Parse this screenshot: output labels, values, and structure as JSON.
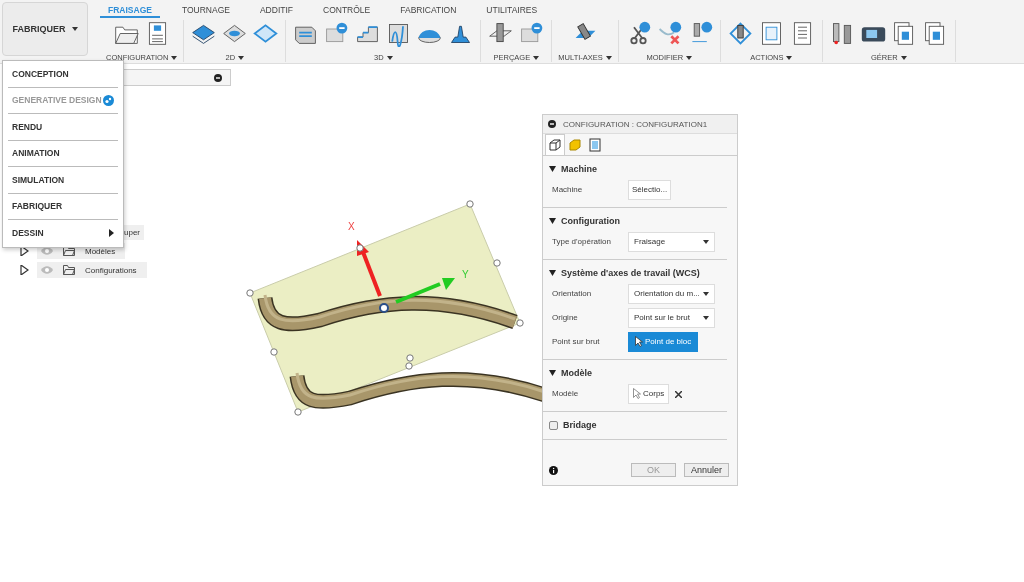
{
  "app_menu": {
    "label": "FABRIQUER"
  },
  "tabs": [
    {
      "label": "FRAISAGE",
      "selected": true
    },
    {
      "label": "TOURNAGE",
      "selected": false
    },
    {
      "label": "ADDITIF",
      "selected": false
    },
    {
      "label": "CONTRÔLE",
      "selected": false
    },
    {
      "label": "FABRICATION",
      "selected": false
    },
    {
      "label": "UTILITAIRES",
      "selected": false
    }
  ],
  "groups": [
    {
      "label": "CONFIGURATION"
    },
    {
      "label": "2D"
    },
    {
      "label": "3D"
    },
    {
      "label": "PERÇAGE"
    },
    {
      "label": "MULTI-AXES"
    },
    {
      "label": "MODIFIER"
    },
    {
      "label": "ACTIONS"
    },
    {
      "label": "GÉRER"
    }
  ],
  "workspace_menu": [
    {
      "label": "CONCEPTION",
      "kind": "plain",
      "disabled": false
    },
    {
      "label": "GENERATIVE DESIGN",
      "kind": "badge",
      "disabled": true
    },
    {
      "label": "RENDU",
      "kind": "plain",
      "disabled": false
    },
    {
      "label": "ANIMATION",
      "kind": "plain",
      "disabled": false
    },
    {
      "label": "SIMULATION",
      "kind": "plain",
      "disabled": false
    },
    {
      "label": "FABRIQUER",
      "kind": "plain",
      "disabled": false
    },
    {
      "label": "DESSIN",
      "kind": "submenu",
      "disabled": false
    }
  ],
  "browser": {
    "items": [
      {
        "label": "uper",
        "kind": "fragment"
      },
      {
        "label": "Modèles",
        "kind": "folder",
        "expanded": false
      },
      {
        "label": "Configurations",
        "kind": "folder",
        "expanded": false
      }
    ]
  },
  "viewport": {
    "x_label": "X",
    "y_label": "Y"
  },
  "panel": {
    "title": "CONFIGURATION : CONFIGURATION1",
    "tabs": [
      {
        "selected": true
      },
      {
        "selected": false
      },
      {
        "selected": false
      }
    ],
    "sections": [
      {
        "title": "Machine",
        "kind": "header",
        "expanded": true,
        "fields": [
          {
            "label": "Machine",
            "kind": "button",
            "value": "Sélectio..."
          }
        ]
      },
      {
        "title": "Configuration",
        "kind": "header",
        "expanded": true,
        "fields": [
          {
            "label": "Type d'opération",
            "kind": "select",
            "value": "Fraisage"
          }
        ]
      },
      {
        "title": "Système d'axes de travail (WCS)",
        "kind": "header",
        "expanded": true,
        "fields": [
          {
            "label": "Orientation",
            "kind": "select",
            "value": "Orientation du m..."
          },
          {
            "label": "Origine",
            "kind": "select",
            "value": "Point sur le brut"
          },
          {
            "label": "Point sur brut",
            "kind": "pick",
            "value": "Point de bloc",
            "selected": true
          }
        ]
      },
      {
        "title": "Modèle",
        "kind": "header",
        "expanded": true,
        "fields": [
          {
            "label": "Modèle",
            "kind": "pick",
            "value": "Corps",
            "selected": false,
            "clearable": true
          }
        ]
      },
      {
        "title": "Bridage",
        "kind": "checkbox",
        "checked": false
      }
    ],
    "buttons": [
      {
        "label": "OK",
        "disabled": true
      },
      {
        "label": "Annuler",
        "disabled": false
      }
    ]
  }
}
